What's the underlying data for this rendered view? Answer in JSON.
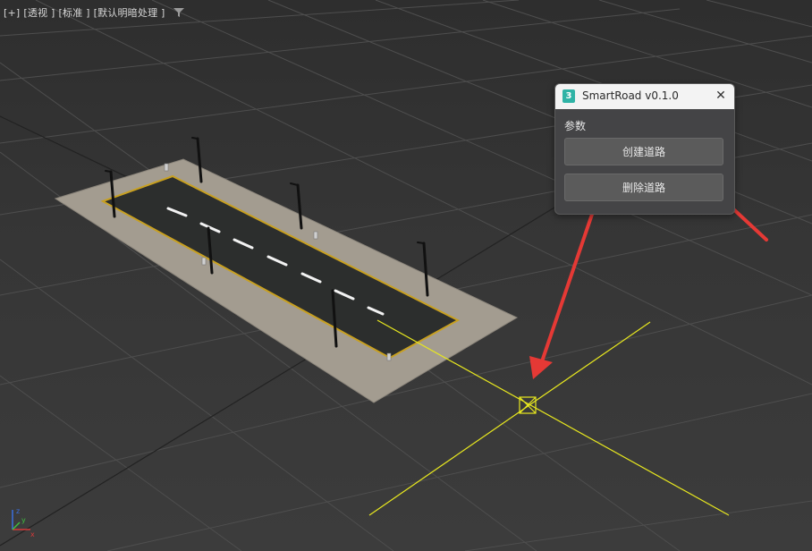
{
  "viewport": {
    "menu": [
      "[+]",
      "[透视 ]",
      "[标准 ]",
      "[默认明暗处理 ]"
    ],
    "filter_icon": "funnel-icon",
    "gizmo_labels": {
      "x": "x",
      "y": "y",
      "z": "z"
    }
  },
  "dialog": {
    "title": "SmartRoad v0.1.0",
    "app_icon": "3",
    "close_glyph": "✕",
    "section_label": "参数",
    "create_road_label": "创建道路",
    "delete_road_label": "删除道路"
  },
  "colors": {
    "viewport_bg": "#363636",
    "dialog_bg": "#444446",
    "button_bg": "#5b5b5b",
    "selection_yellow": "#e8e81f",
    "annotation_arrow": "#e53935",
    "road_edge": "#c8a020",
    "sidewalk": "#a39c90"
  }
}
